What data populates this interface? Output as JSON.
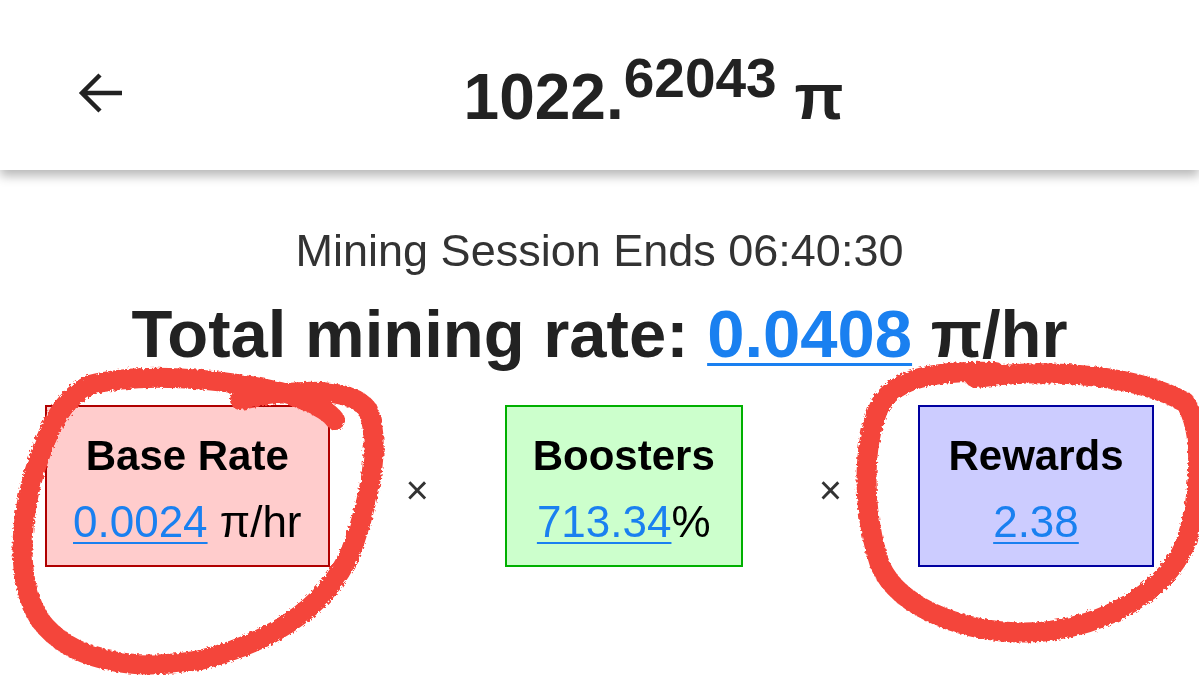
{
  "header": {
    "title": "1022.$^{62043}$ π"
  },
  "session": {
    "text": "Mining Session Ends 06:40:30"
  },
  "total_rate": {
    "label": "Total mining rate:",
    "value": "0.0408",
    "unit": "π/hr"
  },
  "factors": [
    {
      "title": "Base Rate",
      "value": "0.0024",
      "unit": " π/hr",
      "color": "#b00000"
    },
    {
      "title": "Boosters",
      "value": "713.34",
      "unit": "%",
      "color": "#00b000"
    },
    {
      "title": "Rewards",
      "value": "2.38",
      "color": "#0000a0"
    }
  ],
  "operators": [
    "×",
    "×"
  ]
}
